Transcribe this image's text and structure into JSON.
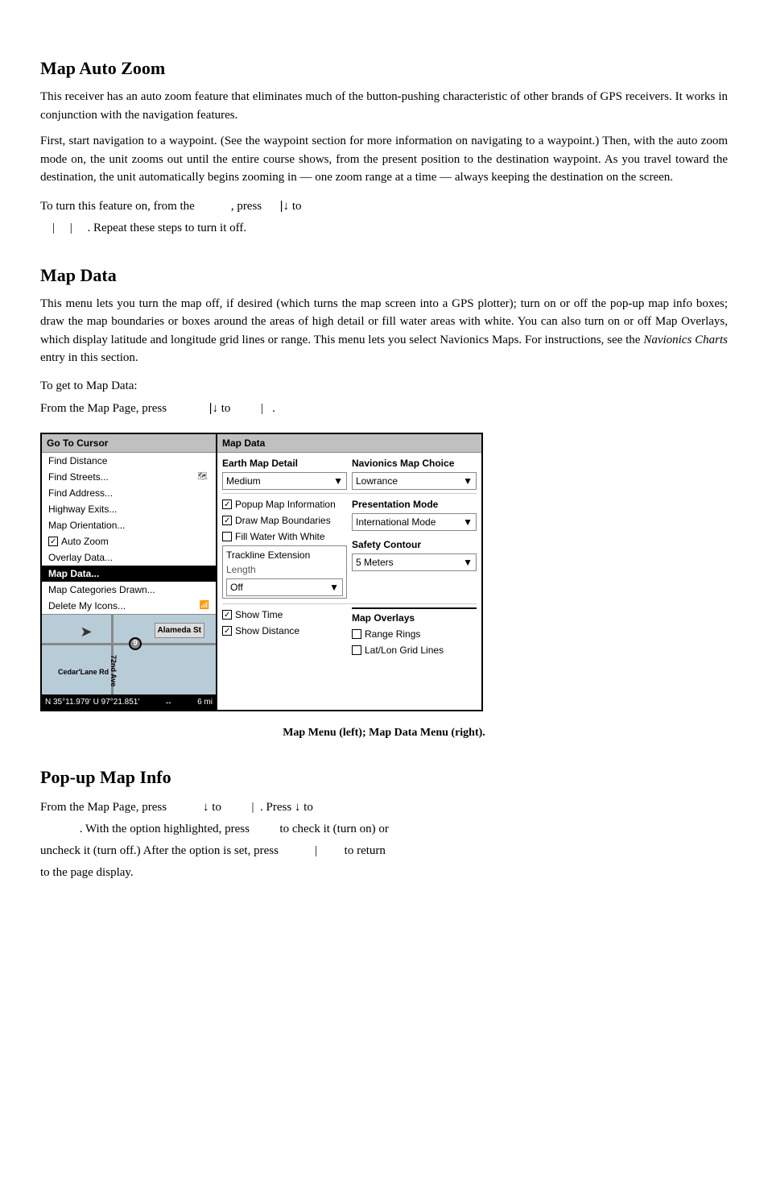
{
  "sections": {
    "map_auto_zoom": {
      "title": "Map Auto Zoom",
      "para1": "This receiver has an auto zoom feature that eliminates much of the button-pushing characteristic of other brands of GPS receivers. It works in conjunction with the navigation features.",
      "para2": "First, start navigation to a waypoint. (See the waypoint section for more information on navigating to a waypoint.) Then, with the auto zoom mode on, the unit zooms out until the entire course shows, from the present position to the destination waypoint. As you travel toward the destination, the unit automatically begins zooming in — one zoom range at a time — always keeping the destination on the screen.",
      "instruction": "To turn this feature on, from the",
      "instruction2": ", press",
      "instruction3": "to",
      "instruction4": "|     |     . Repeat these steps to turn it off."
    },
    "map_data": {
      "title": "Map Data",
      "para1": "This menu lets you turn the map off, if desired (which turns the map screen into a GPS plotter); turn on or off the pop-up map info boxes; draw the map boundaries or boxes around the areas of high detail or fill water areas with white. You can also turn on or off Map Overlays, which display latitude and longitude grid lines or range. This menu lets you select Navionics Maps. For instructions, see the Navionics Charts entry in this section.",
      "instruction_line1": "To get to Map Data:",
      "instruction_line2": "From the Map Page, press",
      "instruction_line2b": "| ↓ to",
      "instruction_line2c": "|   .",
      "figure_caption": "Map Menu (left); Map Data Menu (right)."
    },
    "popup_map_info": {
      "title": "Pop-up Map Info",
      "line1_pre": "From the Map Page, press",
      "line1_mid1": "↓ to",
      "line1_mid2": "|   . Press",
      "line1_mid3": "↓ to",
      "line2": ". With the option highlighted, press",
      "line2b": "to check it (turn on) or",
      "line3": "uncheck it (turn off.) After the option is set, press",
      "line3b": "|",
      "line3c": "to return",
      "line4": "to the page display."
    }
  },
  "left_menu": {
    "title": "Go To Cursor",
    "items": [
      {
        "label": "Find Distance",
        "state": "normal"
      },
      {
        "label": "Find Streets...",
        "state": "normal"
      },
      {
        "label": "Find Address...",
        "state": "normal"
      },
      {
        "label": "Highway Exits...",
        "state": "normal"
      },
      {
        "label": "Map Orientation...",
        "state": "normal"
      },
      {
        "label": "Auto Zoom",
        "state": "checkbox",
        "checked": true
      },
      {
        "label": "Overlay Data...",
        "state": "normal"
      },
      {
        "label": "Map Data...",
        "state": "selected"
      },
      {
        "label": "Map Categories Drawn...",
        "state": "normal"
      },
      {
        "label": "Delete My Icons...",
        "state": "normal"
      }
    ],
    "map_label1": "Alameda St",
    "map_label2": "Cedar'Lane Rd",
    "map_label3": "72nd Ave",
    "coords": "N  35°11.979'  U  97°21.851'",
    "scale": "6 mi",
    "circle_label": "9"
  },
  "right_menu": {
    "title": "Map Data",
    "earth_map_detail_label": "Earth Map Detail",
    "earth_map_detail_value": "Medium",
    "navionics_label": "Navionics Map Choice",
    "navionics_value": "Lowrance",
    "popup_map_info_label": "Popup Map Information",
    "popup_map_info_checked": true,
    "draw_map_label": "Draw Map Boundaries",
    "draw_map_checked": true,
    "fill_water_label": "Fill Water With White",
    "fill_water_checked": false,
    "trackline_label": "Trackline Extension",
    "trackline_sub": "Length",
    "trackline_value": "Off",
    "presentation_label": "Presentation Mode",
    "presentation_value": "International Mode",
    "safety_contour_label": "Safety Contour",
    "safety_contour_value": "5 Meters",
    "map_overlays_label": "Map Overlays",
    "range_rings_label": "Range Rings",
    "range_rings_checked": false,
    "lat_lon_label": "Lat/Lon Grid Lines",
    "lat_lon_checked": false,
    "show_time_label": "Show Time",
    "show_time_checked": true,
    "show_distance_label": "Show Distance",
    "show_distance_checked": true
  }
}
